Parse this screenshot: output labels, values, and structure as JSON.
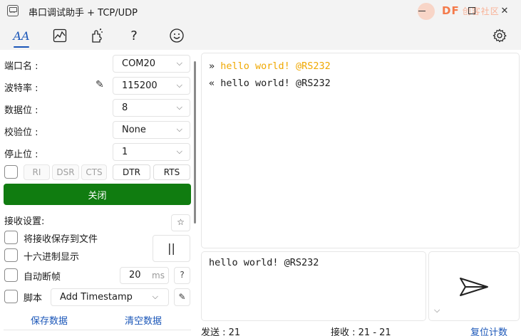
{
  "window": {
    "title": "串口调试助手 + TCP/UDP",
    "watermark": "DF",
    "watermark_sub": "创客社区",
    "min_icon": "minimize-icon",
    "max_icon": "maximize-icon",
    "close_glyph": "✕"
  },
  "toolbar": {
    "font_glyph": "AA",
    "help_glyph": "?",
    "icons": [
      "font-icon",
      "chart-icon",
      "plugin-icon",
      "help-icon",
      "emoji-icon",
      "settings-icon"
    ]
  },
  "serial": {
    "port_label": "端口名 :",
    "port_value": "COM20",
    "baud_label": "波特率 :",
    "baud_value": "115200",
    "databits_label": "数据位 :",
    "databits_value": "8",
    "parity_label": "校验位 :",
    "parity_value": "None",
    "stopbits_label": "停止位 :",
    "stopbits_value": "1",
    "signals": {
      "ri": "RI",
      "dsr": "DSR",
      "cts": "CTS",
      "dtr": "DTR",
      "rts": "RTS"
    },
    "close_label": "关闭"
  },
  "receive": {
    "title": "接收设置:",
    "save_to_file": "将接收保存到文件",
    "hex_display": "十六进制显示",
    "auto_frame": "自动断帧",
    "frame_ms_value": "20",
    "frame_ms_unit": "ms",
    "script_label": "脚本",
    "script_value": "Add Timestamp",
    "save_data_link": "保存数据",
    "clear_data_link": "清空数据",
    "pause_glyph": "||",
    "star_glyph": "☆",
    "help_glyph": "?"
  },
  "log": {
    "lines": [
      {
        "dir": "»",
        "text": "hello world! @RS232",
        "kind": "sent"
      },
      {
        "dir": "«",
        "text": "hello world! @RS232",
        "kind": "recv"
      }
    ]
  },
  "send": {
    "input_value": "hello world! @RS232"
  },
  "status": {
    "sent_label": "发送 : 21",
    "recv_label": "接收 : 21 - 21",
    "reset_link": "复位计数"
  },
  "colors": {
    "accent": "#1a56b8",
    "close_button": "#107c10",
    "sent_text": "#f0a800"
  }
}
